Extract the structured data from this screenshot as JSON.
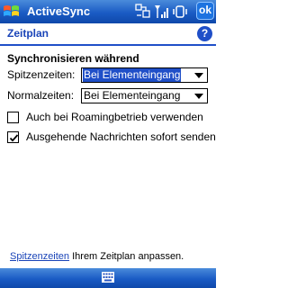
{
  "titlebar": {
    "app_title": "ActiveSync",
    "ok_label": "ok",
    "icons": [
      "windows-start-icon",
      "connectivity-icon",
      "signal-strength-icon",
      "volume-icon"
    ]
  },
  "header": {
    "title": "Zeitplan",
    "help_label": "?"
  },
  "sync": {
    "section_title": "Synchronisieren während",
    "peak_label": "Spitzenzeiten:",
    "peak_value": "Bei Elementeingang",
    "offpeak_label": "Normalzeiten:",
    "offpeak_value": "Bei Elementeingang"
  },
  "options": {
    "roaming_label": "Auch bei Roamingbetrieb verwenden",
    "roaming_checked": false,
    "send_now_label": "Ausgehende Nachrichten sofort senden",
    "send_now_checked": true
  },
  "footer": {
    "link_text": "Spitzenzeiten",
    "text": " Ihrem Zeitplan anpassen."
  },
  "colors": {
    "accent": "#1f4fc8",
    "titlebar": "#1a5bc4"
  }
}
